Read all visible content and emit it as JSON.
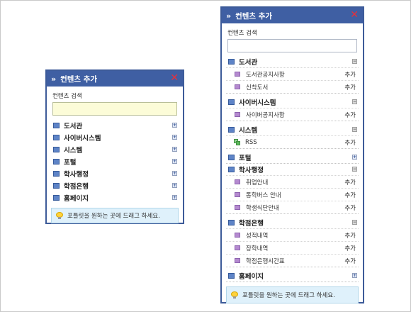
{
  "panel_small": {
    "title": "컨텐츠 추가",
    "search_label": "컨텐츠 검색",
    "search_value": "",
    "categories": [
      {
        "label": "도서관"
      },
      {
        "label": "사이버시스템"
      },
      {
        "label": "시스템"
      },
      {
        "label": "포털"
      },
      {
        "label": "학사행정"
      },
      {
        "label": "학점은행"
      },
      {
        "label": "홈페이지"
      }
    ],
    "tip": "포틀릿을 원하는 곳에 드래그 하세요."
  },
  "panel_large": {
    "title": "컨텐츠 추가",
    "search_label": "컨텐츠 검색",
    "search_value": "",
    "add_label": "추가",
    "categories": [
      {
        "label": "도서관",
        "items": [
          "도서관공지사항",
          "신착도서"
        ]
      },
      {
        "label": "사이버시스템",
        "items": [
          "사이버공지사항"
        ]
      },
      {
        "label": "시스템",
        "items": [
          "RSS"
        ]
      },
      {
        "label": "포털",
        "items": []
      },
      {
        "label": "학사행정",
        "items": [
          "취업안내",
          "통학버스 안내",
          "학생식단안내"
        ]
      },
      {
        "label": "학점은행",
        "items": [
          "성적내역",
          "장학내역",
          "학점은행시간표"
        ]
      },
      {
        "label": "홈페이지",
        "items": []
      }
    ],
    "tip": "포틀릿을 원하는 곳에 드래그 하세요."
  },
  "icons": {
    "title_arrow": "»",
    "close": "✕",
    "expand": "+",
    "collapse": "−"
  },
  "colors": {
    "titlebar": "#3f5fa3",
    "close": "#e8303a",
    "category_square": "#5e84c7",
    "item_square": "#b58ad0",
    "tip_background": "#dff1fb"
  }
}
